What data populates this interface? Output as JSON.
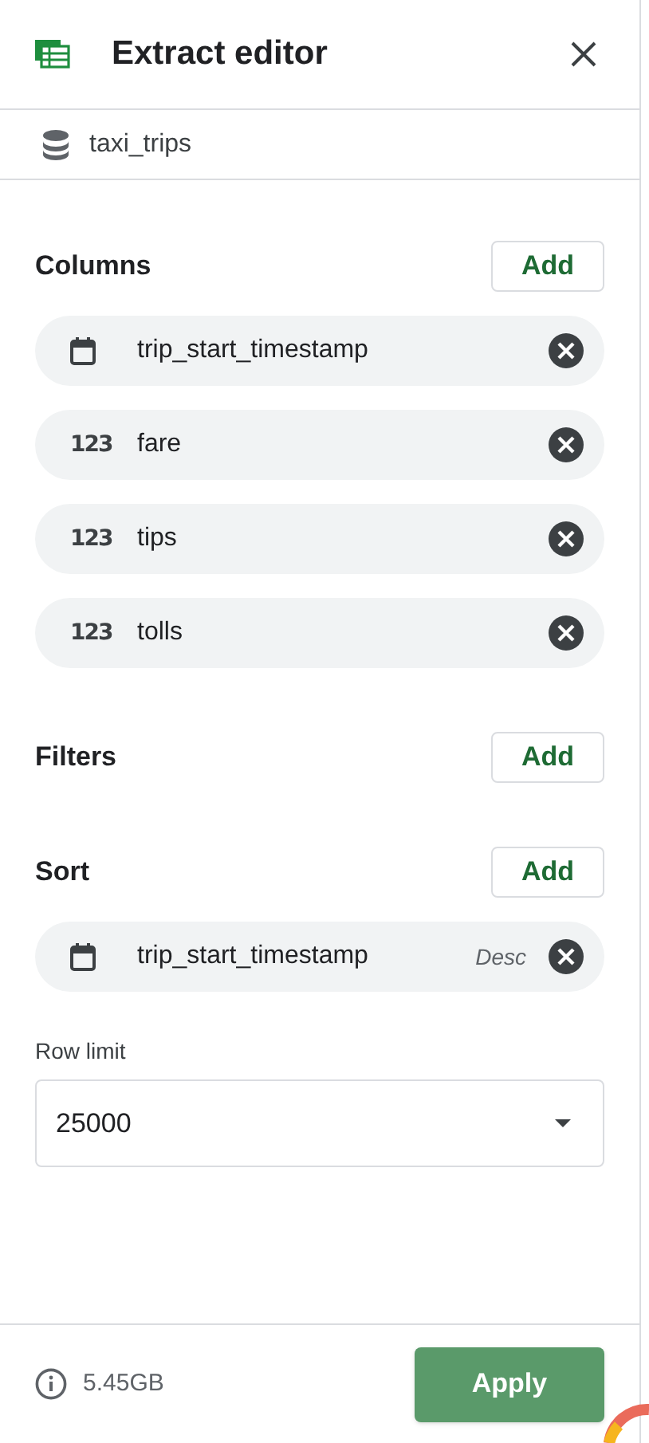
{
  "header": {
    "title": "Extract editor"
  },
  "source": {
    "name": "taxi_trips"
  },
  "sections": [
    {
      "title": "Columns",
      "action": "Add",
      "chips": [
        {
          "kind": "date",
          "name": "trip_start_timestamp"
        },
        {
          "kind": "number",
          "type_label": "123",
          "name": "fare"
        },
        {
          "kind": "number",
          "type_label": "123",
          "name": "tips"
        },
        {
          "kind": "number",
          "type_label": "123",
          "name": "tolls"
        }
      ]
    },
    {
      "title": "Filters",
      "action": "Add"
    },
    {
      "title": "Sort",
      "action": "Add",
      "chips": [
        {
          "kind": "date",
          "name": "trip_start_timestamp",
          "order": "Desc"
        }
      ]
    }
  ],
  "row_limit": {
    "label": "Row limit",
    "value": "25000"
  },
  "footer": {
    "size": "5.45GB",
    "button": "Apply"
  }
}
